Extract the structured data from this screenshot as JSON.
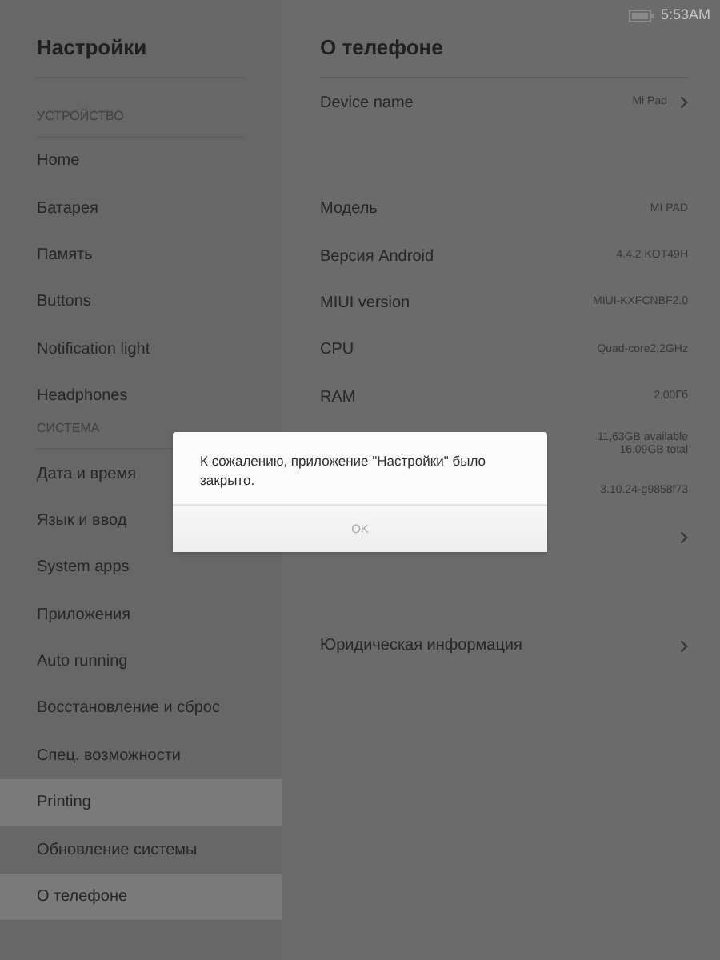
{
  "status_bar": {
    "time": "5:53AM"
  },
  "sidebar": {
    "title": "Настройки",
    "sections": [
      {
        "header": "УСТРОЙСТВО",
        "items": [
          {
            "label": "Home",
            "selected": false
          },
          {
            "label": "Батарея",
            "selected": false
          },
          {
            "label": "Память",
            "selected": false
          },
          {
            "label": "Buttons",
            "selected": false
          },
          {
            "label": "Notification light",
            "selected": false
          },
          {
            "label": "Headphones",
            "selected": false
          }
        ]
      },
      {
        "header": "СИСТЕМА",
        "items": [
          {
            "label": "Дата и время",
            "selected": false
          },
          {
            "label": "Язык и ввод",
            "selected": false
          },
          {
            "label": "System apps",
            "selected": false
          },
          {
            "label": "Приложения",
            "selected": false
          },
          {
            "label": "Auto running",
            "selected": false
          },
          {
            "label": "Восстановление и сброс",
            "selected": false
          },
          {
            "label": "Спец. возможности",
            "selected": false
          },
          {
            "label": "Printing",
            "selected": true
          },
          {
            "label": "Обновление системы",
            "selected": false
          },
          {
            "label": "О телефоне",
            "selected": true
          }
        ]
      }
    ]
  },
  "detail": {
    "title": "О телефоне",
    "groups": [
      [
        {
          "label": "Device name",
          "value": "Mi Pad",
          "chevron": true
        }
      ],
      [
        {
          "label": "Модель",
          "value": "MI PAD",
          "chevron": false
        },
        {
          "label": "Версия Android",
          "value": "4.4.2 KOT49H",
          "chevron": false
        },
        {
          "label": "MIUI version",
          "value": "MIUI-KXFCNBF2.0",
          "chevron": false
        },
        {
          "label": "CPU",
          "value": "Quad-core2,2GHz",
          "chevron": false
        },
        {
          "label": "RAM",
          "value": "2,00Гб",
          "chevron": false
        },
        {
          "value": "11,63GB available\n16,09GB total",
          "chevron": false
        },
        {
          "value": "3.10.24-g9858f73",
          "chevron": false
        },
        {
          "chevron": true
        }
      ],
      [
        {
          "label": "Юридическая информация",
          "chevron": true
        }
      ]
    ]
  },
  "dialog": {
    "message": "К сожалению, приложение \"Настройки\" было закрыто.",
    "button": "OK"
  }
}
